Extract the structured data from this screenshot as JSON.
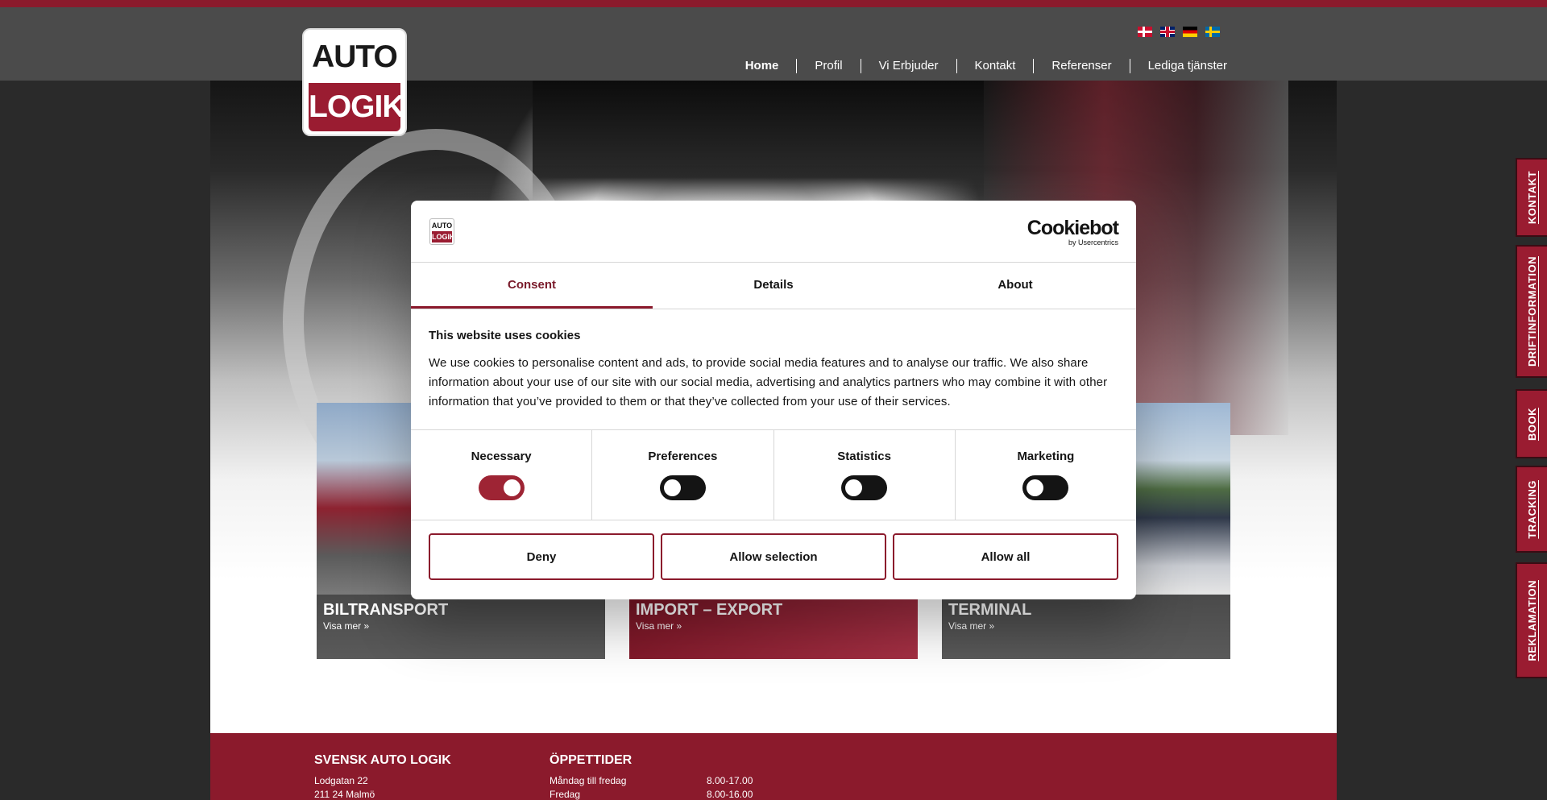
{
  "header": {
    "logo_top": "AUTO",
    "logo_bottom": "LOGIK",
    "nav": [
      "Home",
      "Profil",
      "Vi Erbjuder",
      "Kontakt",
      "Referenser",
      "Lediga tjänster"
    ]
  },
  "flags": [
    "danish-flag-icon",
    "uk-flag-icon",
    "german-flag-icon",
    "swedish-flag-icon"
  ],
  "cards": [
    {
      "title": "BILTRANSPORT",
      "link": "Visa mer »"
    },
    {
      "title": "IMPORT – EXPORT",
      "link": "Visa mer »"
    },
    {
      "title": "TERMINAL",
      "link": "Visa mer »"
    }
  ],
  "sidetabs": [
    "KONTAKT",
    "DRIFTINFORMATION",
    "BOOK",
    "TRACKING",
    "REKLAMATION"
  ],
  "footer": {
    "company_title": "SVENSK AUTO LOGIK",
    "address_line1": "Lodgatan 22",
    "address_line2": "211 24 Malmö",
    "hours_title": "ÖPPETTIDER",
    "hours": [
      {
        "day": "Måndag till fredag",
        "time": "8.00-17.00"
      },
      {
        "day": "Fredag",
        "time": "8.00-16.00"
      }
    ]
  },
  "cookie_dialog": {
    "mini_logo_top": "AUTO",
    "mini_logo_bottom": "LOGIK",
    "brand": "Cookiebot",
    "brand_sub": "by Usercentrics",
    "tabs": [
      "Consent",
      "Details",
      "About"
    ],
    "active_tab": "Consent",
    "heading": "This website uses cookies",
    "text": "We use cookies to personalise content and ads, to provide social media features and to analyse our traffic. We also share information about your use of our site with our social media, advertising and analytics partners who may combine it with other information that you’ve provided to them or that they’ve collected from your use of their services.",
    "toggles": [
      {
        "label": "Necessary",
        "on": true
      },
      {
        "label": "Preferences",
        "on": false
      },
      {
        "label": "Statistics",
        "on": false
      },
      {
        "label": "Marketing",
        "on": false
      }
    ],
    "buttons": [
      "Deny",
      "Allow selection",
      "Allow all"
    ]
  },
  "colors": {
    "brand_red": "#8b1a2c",
    "header_gray": "#4b4b4b",
    "toggle_on": "#9e2434"
  }
}
